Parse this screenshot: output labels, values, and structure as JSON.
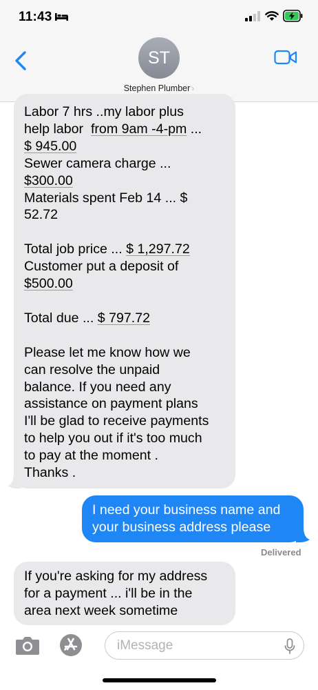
{
  "status_bar": {
    "time": "11:43"
  },
  "header": {
    "avatar_initials": "ST",
    "contact_name": "Stephen Plumber",
    "chevron": "›"
  },
  "messages": [
    {
      "direction": "incoming",
      "lines": [
        "Labor 7 hrs ..my labor plus",
        [
          "help labor  ",
          "from 9am -4-pm",
          " ..."
        ],
        "$ 945.00",
        "Sewer camera charge ...",
        "$300.00",
        "Materials spent Feb 14 ... $",
        "52.72",
        "",
        [
          "Total job price ... ",
          "$ 1,297.72"
        ],
        "Customer put a deposit of",
        "$500.00",
        "",
        [
          "Total due ... ",
          "$ 797.72"
        ],
        "",
        "Please let me know how we",
        "can resolve the unpaid",
        "balance. If you need any",
        "assistance on payment plans",
        "I'll be glad to receive payments",
        "to help you out if it's too much",
        "to pay at the moment .",
        "Thanks ."
      ]
    },
    {
      "direction": "outgoing",
      "lines": [
        "I need your business name and",
        "your business address please"
      ]
    },
    {
      "direction": "incoming",
      "lines": [
        "If you're asking for my address",
        "for a payment ... i'll be in the",
        "area next week sometime"
      ]
    }
  ],
  "delivery_status": "Delivered",
  "input_bar": {
    "placeholder": "iMessage"
  },
  "icons": {
    "status": [
      "bed-icon",
      "signal-icon",
      "wifi-icon",
      "battery-charging-icon"
    ],
    "header": [
      "back-chevron-icon",
      "video-camera-icon"
    ],
    "input": [
      "camera-icon",
      "app-store-icon",
      "microphone-icon"
    ]
  },
  "colors": {
    "accent": "#1f86f6",
    "incoming_bubble": "#e9e9eb",
    "battery_charging": "#34c759"
  }
}
